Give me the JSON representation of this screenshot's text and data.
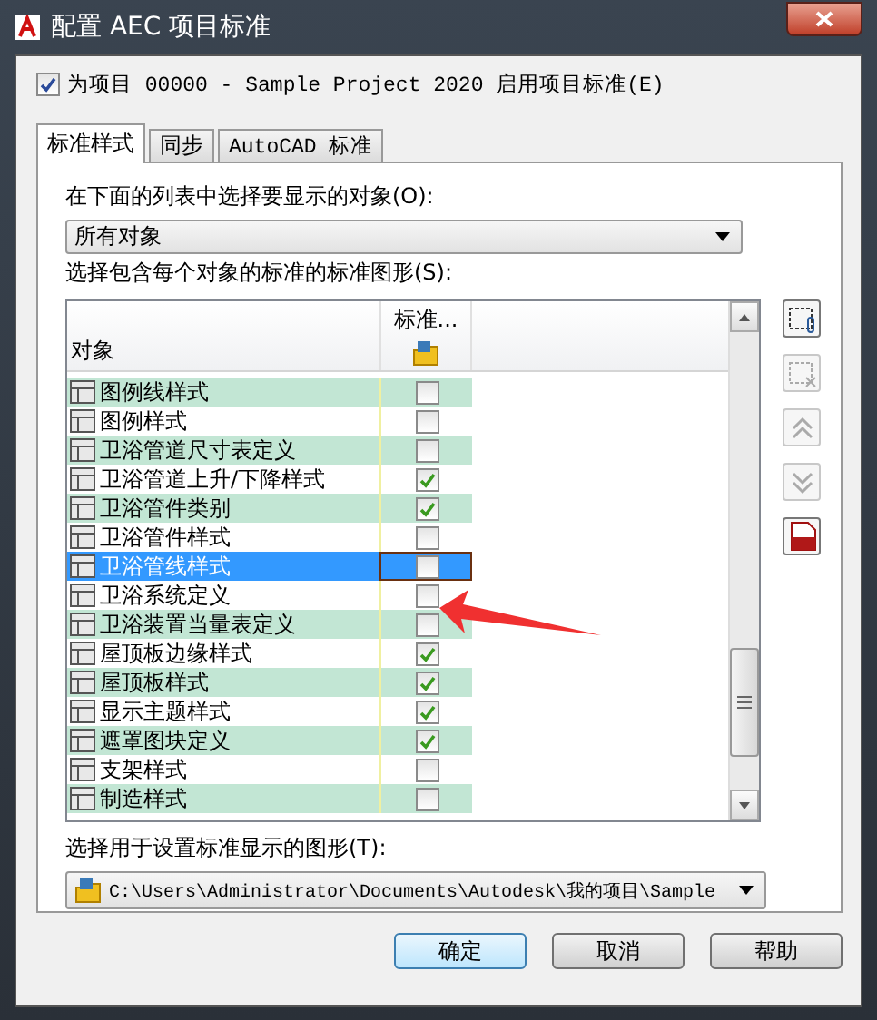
{
  "window": {
    "title": "配置 AEC 项目标准"
  },
  "enable_checkbox": {
    "label": "为项目 00000 - Sample Project 2020 启用项目标准(E)",
    "checked": true
  },
  "tabs": [
    {
      "label": "标准样式",
      "selected": true
    },
    {
      "label": "同步",
      "selected": false
    },
    {
      "label": "AutoCAD 标准",
      "selected": false
    }
  ],
  "object_label": "在下面的列表中选择要显示的对象(O):",
  "object_dropdown": {
    "value": "所有对象"
  },
  "list_label": "选择包含每个对象的标准的标准图形(S):",
  "table": {
    "columns": [
      "对象",
      "标准..."
    ],
    "rows": [
      {
        "name": "图例线样式",
        "checked": false,
        "selected": false
      },
      {
        "name": "图例样式",
        "checked": false,
        "selected": false
      },
      {
        "name": "卫浴管道尺寸表定义",
        "checked": false,
        "selected": false
      },
      {
        "name": "卫浴管道上升/下降样式",
        "checked": true,
        "selected": false
      },
      {
        "name": "卫浴管件类别",
        "checked": true,
        "selected": false
      },
      {
        "name": "卫浴管件样式",
        "checked": false,
        "selected": false
      },
      {
        "name": "卫浴管线样式",
        "checked": false,
        "selected": true
      },
      {
        "name": "卫浴系统定义",
        "checked": false,
        "selected": false
      },
      {
        "name": "卫浴装置当量表定义",
        "checked": false,
        "selected": false
      },
      {
        "name": "屋顶板边缘样式",
        "checked": true,
        "selected": false
      },
      {
        "name": "屋顶板样式",
        "checked": true,
        "selected": false
      },
      {
        "name": "显示主题样式",
        "checked": true,
        "selected": false
      },
      {
        "name": "遮罩图块定义",
        "checked": true,
        "selected": false
      },
      {
        "name": "支架样式",
        "checked": false,
        "selected": false
      },
      {
        "name": "制造样式",
        "checked": false,
        "selected": false
      }
    ]
  },
  "side_buttons": [
    {
      "kind": "add",
      "disabled": false
    },
    {
      "kind": "remove",
      "disabled": true
    },
    {
      "kind": "up",
      "disabled": true
    },
    {
      "kind": "down",
      "disabled": true
    },
    {
      "kind": "apj",
      "disabled": false
    }
  ],
  "display_label": "选择用于设置标准显示的图形(T):",
  "display_dropdown": {
    "value": "C:\\Users\\Administrator\\Documents\\Autodesk\\我的项目\\Sample"
  },
  "buttons": [
    {
      "label": "确定",
      "default": true
    },
    {
      "label": "取消",
      "default": false
    },
    {
      "label": "帮助",
      "default": false
    }
  ]
}
